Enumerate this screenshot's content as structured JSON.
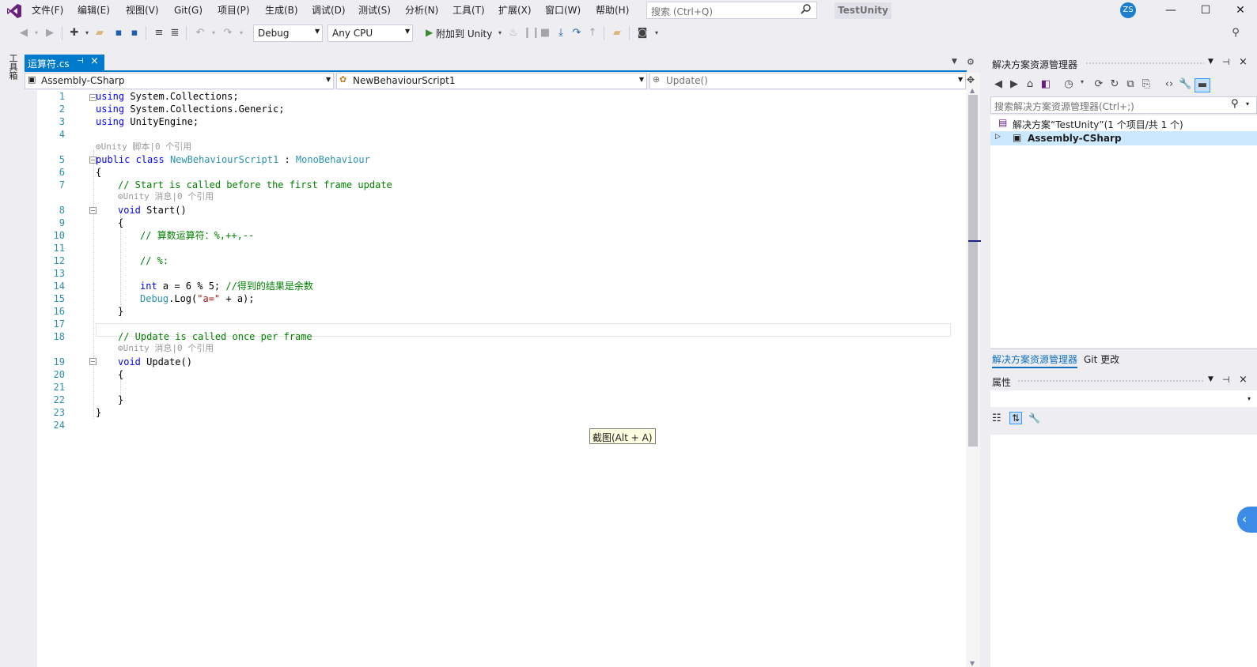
{
  "menu": {
    "items": [
      "文件(F)",
      "编辑(E)",
      "视图(V)",
      "Git(G)",
      "项目(P)",
      "生成(B)",
      "调试(D)",
      "测试(S)",
      "分析(N)",
      "工具(T)",
      "扩展(X)",
      "窗口(W)",
      "帮助(H)"
    ],
    "search_placeholder": "搜索 (Ctrl+Q)",
    "project_title": "TestUnity",
    "avatar_initials": "ZS"
  },
  "toolbar": {
    "configuration": "Debug",
    "platform": "Any CPU",
    "attach_label": "附加到 Unity"
  },
  "toolbox": {
    "label": "工具箱"
  },
  "editor": {
    "tab_label": "运算符.cs",
    "nav": {
      "project": "Assembly-CSharp",
      "class": "NewBehaviourScript1",
      "member": "Update()"
    },
    "lens": {
      "class": "Unity 脚本|0 个引用",
      "start": "Unity 消息|0 个引用",
      "update": "Unity 消息|0 个引用"
    },
    "line_numbers": [
      "1",
      "2",
      "3",
      "4",
      "5",
      "6",
      "7",
      "8",
      "9",
      "10",
      "11",
      "12",
      "13",
      "14",
      "15",
      "16",
      "17",
      "18",
      "19",
      "20",
      "21",
      "22",
      "23",
      "24"
    ],
    "code": {
      "l1_kw": "using",
      "l1_rest": " System.Collections;",
      "l2_kw": "using",
      "l2_rest": " System.Collections.Generic;",
      "l3_kw": "using",
      "l3_rest": " UnityEngine;",
      "l5_kw": "public class",
      "l5_cls": "NewBehaviourScript1",
      "l5_colon": " : ",
      "l5_base": "MonoBehaviour",
      "l6": "{",
      "l7_cmt": "// Start is called before the first frame update",
      "l8_kw": "void",
      "l8_rest": " Start()",
      "l9": "{",
      "l10_cmt": "// 算数运算符：%,++,--",
      "l12_cmt": "// %:",
      "l14_kw": "int",
      "l14_rest": " a = 6 % 5;",
      "l14_cmt": " //得到的结果是余数",
      "l15_cls": "Debug",
      "l15_a": ".Log(",
      "l15_str": "\"a=\"",
      "l15_b": " + a);",
      "l16": "}",
      "l18_cmt": "// Update is called once per frame",
      "l19_kw": "void",
      "l19_rest": " Update()",
      "l20": "{",
      "l22": "}",
      "l23": "}"
    },
    "tooltip": "截图(Alt + A)"
  },
  "solution_explorer": {
    "title": "解决方案资源管理器",
    "search_placeholder": "搜索解决方案资源管理器(Ctrl+;)",
    "solution_label": "解决方案“TestUnity”(1 个项目/共 1 个)",
    "project_label": "Assembly-CSharp",
    "tabs": [
      "解决方案资源管理器",
      "Git 更改"
    ]
  },
  "properties": {
    "title": "属性"
  },
  "colors": {
    "accent": "#007acc",
    "keyword": "#0000ff",
    "type": "#2b91af",
    "comment": "#008000",
    "string": "#a31515"
  }
}
